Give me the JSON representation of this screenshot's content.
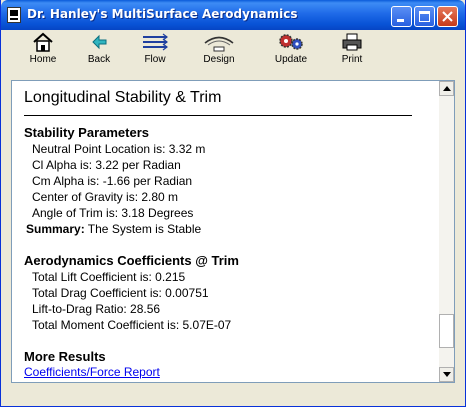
{
  "window": {
    "title": "Dr. Hanley's MultiSurface Aerodynamics"
  },
  "toolbar": {
    "home": "Home",
    "back": "Back",
    "flow": "Flow",
    "design": "Design",
    "update": "Update",
    "print": "Print"
  },
  "document": {
    "title": "Longitudinal Stability & Trim",
    "stability": {
      "heading": "Stability Parameters",
      "neutral_point": "Neutral Point Location is: 3.32 m",
      "cl_alpha": "Cl Alpha is: 3.22 per Radian",
      "cm_alpha": "Cm Alpha is: -1.66 per Radian",
      "cg": "Center of Gravity is: 2.80 m",
      "trim_angle": "Angle of Trim is: 3.18 Degrees",
      "summary_label": "Summary:",
      "summary_text": " The System is Stable"
    },
    "coefficients": {
      "heading": "Aerodynamics Coefficients @ Trim",
      "lift": "Total Lift Coefficient is: 0.215",
      "drag": "Total Drag Coefficient is: 0.00751",
      "ld": "Lift-to-Drag Ratio: 28.56",
      "moment": "Total Moment Coefficient is: 5.07E-07"
    },
    "more": {
      "heading": "More Results",
      "link": "Coefficients/Force Report"
    }
  },
  "scrollbar": {
    "position_fraction": 0.92
  },
  "colors": {
    "titlebar": "#0853d6",
    "link": "#0000ee",
    "chrome": "#ece9d8"
  }
}
